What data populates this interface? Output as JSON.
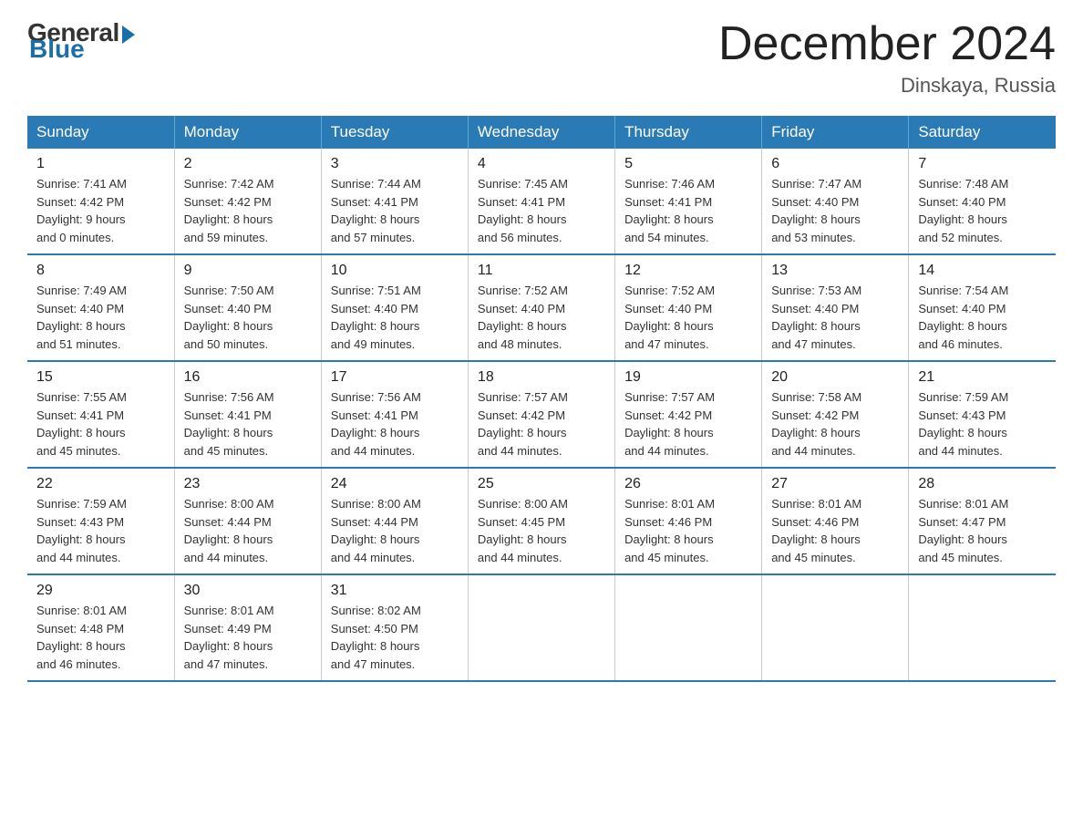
{
  "header": {
    "logo_general": "General",
    "logo_blue": "Blue",
    "title": "December 2024",
    "location": "Dinskaya, Russia"
  },
  "days_of_week": [
    "Sunday",
    "Monday",
    "Tuesday",
    "Wednesday",
    "Thursday",
    "Friday",
    "Saturday"
  ],
  "weeks": [
    [
      {
        "day": "1",
        "sunrise": "7:41 AM",
        "sunset": "4:42 PM",
        "daylight": "9 hours and 0 minutes."
      },
      {
        "day": "2",
        "sunrise": "7:42 AM",
        "sunset": "4:42 PM",
        "daylight": "8 hours and 59 minutes."
      },
      {
        "day": "3",
        "sunrise": "7:44 AM",
        "sunset": "4:41 PM",
        "daylight": "8 hours and 57 minutes."
      },
      {
        "day": "4",
        "sunrise": "7:45 AM",
        "sunset": "4:41 PM",
        "daylight": "8 hours and 56 minutes."
      },
      {
        "day": "5",
        "sunrise": "7:46 AM",
        "sunset": "4:41 PM",
        "daylight": "8 hours and 54 minutes."
      },
      {
        "day": "6",
        "sunrise": "7:47 AM",
        "sunset": "4:40 PM",
        "daylight": "8 hours and 53 minutes."
      },
      {
        "day": "7",
        "sunrise": "7:48 AM",
        "sunset": "4:40 PM",
        "daylight": "8 hours and 52 minutes."
      }
    ],
    [
      {
        "day": "8",
        "sunrise": "7:49 AM",
        "sunset": "4:40 PM",
        "daylight": "8 hours and 51 minutes."
      },
      {
        "day": "9",
        "sunrise": "7:50 AM",
        "sunset": "4:40 PM",
        "daylight": "8 hours and 50 minutes."
      },
      {
        "day": "10",
        "sunrise": "7:51 AM",
        "sunset": "4:40 PM",
        "daylight": "8 hours and 49 minutes."
      },
      {
        "day": "11",
        "sunrise": "7:52 AM",
        "sunset": "4:40 PM",
        "daylight": "8 hours and 48 minutes."
      },
      {
        "day": "12",
        "sunrise": "7:52 AM",
        "sunset": "4:40 PM",
        "daylight": "8 hours and 47 minutes."
      },
      {
        "day": "13",
        "sunrise": "7:53 AM",
        "sunset": "4:40 PM",
        "daylight": "8 hours and 47 minutes."
      },
      {
        "day": "14",
        "sunrise": "7:54 AM",
        "sunset": "4:40 PM",
        "daylight": "8 hours and 46 minutes."
      }
    ],
    [
      {
        "day": "15",
        "sunrise": "7:55 AM",
        "sunset": "4:41 PM",
        "daylight": "8 hours and 45 minutes."
      },
      {
        "day": "16",
        "sunrise": "7:56 AM",
        "sunset": "4:41 PM",
        "daylight": "8 hours and 45 minutes."
      },
      {
        "day": "17",
        "sunrise": "7:56 AM",
        "sunset": "4:41 PM",
        "daylight": "8 hours and 44 minutes."
      },
      {
        "day": "18",
        "sunrise": "7:57 AM",
        "sunset": "4:42 PM",
        "daylight": "8 hours and 44 minutes."
      },
      {
        "day": "19",
        "sunrise": "7:57 AM",
        "sunset": "4:42 PM",
        "daylight": "8 hours and 44 minutes."
      },
      {
        "day": "20",
        "sunrise": "7:58 AM",
        "sunset": "4:42 PM",
        "daylight": "8 hours and 44 minutes."
      },
      {
        "day": "21",
        "sunrise": "7:59 AM",
        "sunset": "4:43 PM",
        "daylight": "8 hours and 44 minutes."
      }
    ],
    [
      {
        "day": "22",
        "sunrise": "7:59 AM",
        "sunset": "4:43 PM",
        "daylight": "8 hours and 44 minutes."
      },
      {
        "day": "23",
        "sunrise": "8:00 AM",
        "sunset": "4:44 PM",
        "daylight": "8 hours and 44 minutes."
      },
      {
        "day": "24",
        "sunrise": "8:00 AM",
        "sunset": "4:44 PM",
        "daylight": "8 hours and 44 minutes."
      },
      {
        "day": "25",
        "sunrise": "8:00 AM",
        "sunset": "4:45 PM",
        "daylight": "8 hours and 44 minutes."
      },
      {
        "day": "26",
        "sunrise": "8:01 AM",
        "sunset": "4:46 PM",
        "daylight": "8 hours and 45 minutes."
      },
      {
        "day": "27",
        "sunrise": "8:01 AM",
        "sunset": "4:46 PM",
        "daylight": "8 hours and 45 minutes."
      },
      {
        "day": "28",
        "sunrise": "8:01 AM",
        "sunset": "4:47 PM",
        "daylight": "8 hours and 45 minutes."
      }
    ],
    [
      {
        "day": "29",
        "sunrise": "8:01 AM",
        "sunset": "4:48 PM",
        "daylight": "8 hours and 46 minutes."
      },
      {
        "day": "30",
        "sunrise": "8:01 AM",
        "sunset": "4:49 PM",
        "daylight": "8 hours and 47 minutes."
      },
      {
        "day": "31",
        "sunrise": "8:02 AM",
        "sunset": "4:50 PM",
        "daylight": "8 hours and 47 minutes."
      },
      null,
      null,
      null,
      null
    ]
  ]
}
